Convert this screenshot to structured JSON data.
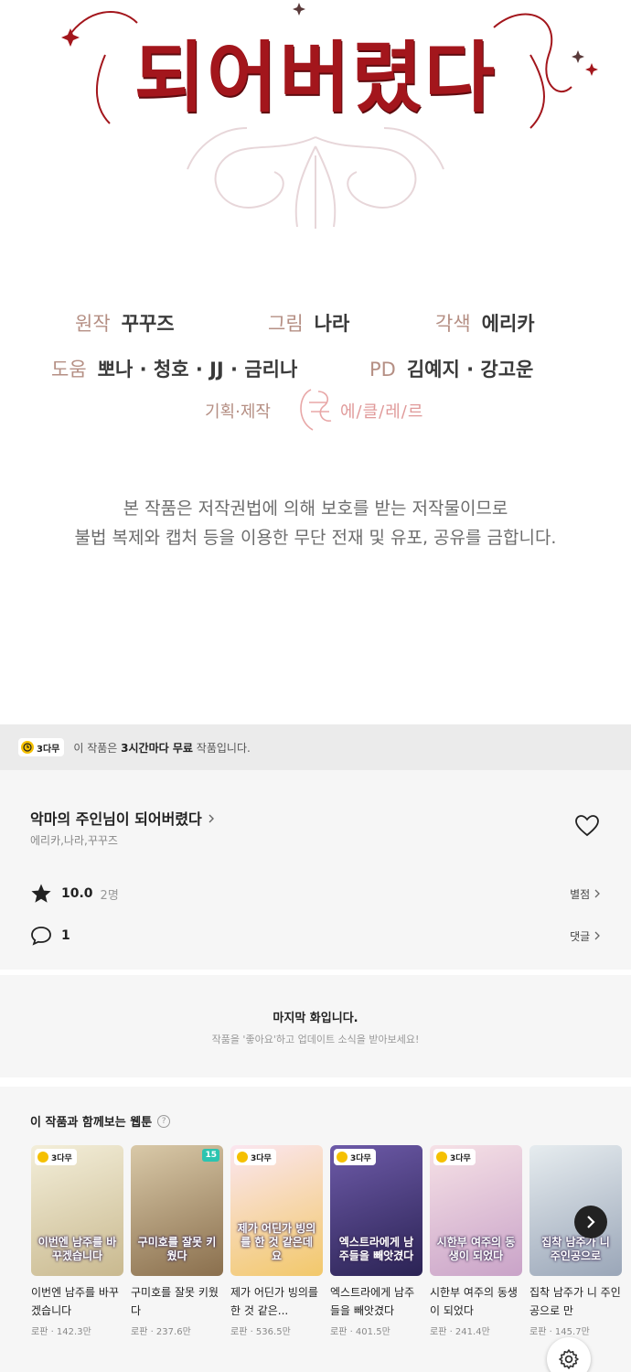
{
  "title_art": {
    "title": "되어버렸다"
  },
  "credits": {
    "original_label": "원작",
    "original_value": "꾸꾸즈",
    "art_label": "그림",
    "art_value": "나라",
    "adapt_label": "각색",
    "adapt_value": "에리카",
    "assist_label": "도움",
    "assist_value": "뽀나 · 청호 · JJ · 금리나",
    "pd_label": "PD",
    "pd_value": "김예지 · 강고운",
    "studio_label": "기획·제작",
    "studio_name": "에/클/레/르"
  },
  "copyright": {
    "line1": "본 작품은 저작권법에 의해 보호를 받는 저작물이므로",
    "line2": "불법 복제와 캡처 등을 이용한 무단 전재 및 유포, 공유를 금합니다."
  },
  "free_bar": {
    "badge": "3다무",
    "text_prefix": "이 작품은",
    "text_bold": "3시간마다 무료",
    "text_suffix": "작품입니다."
  },
  "series": {
    "title": "악마의 주인님이 되어버렸다",
    "authors": "에리카,나라,꾸꾸즈",
    "rating": "10.0",
    "rating_count": "2명",
    "rating_link": "별점",
    "comments": "1",
    "comment_link": "댓글"
  },
  "last_episode": {
    "title": "마지막 화입니다.",
    "subtitle": "작품을 '좋아요'하고 업데이트 소식을 받아보세요!"
  },
  "recommendations": {
    "heading": "이 작품과 함께보는 웹툰",
    "help": "?",
    "items": [
      {
        "badge": "3다무",
        "ep": "",
        "cover": "이번엔 남주를 바꾸겠습니다",
        "title": "이번엔 남주를 바꾸겠습니다",
        "meta": "로판 · 142.3만",
        "c1": "#f3eed9",
        "c2": "#c9b98f"
      },
      {
        "badge": "",
        "ep": "15",
        "cover": "구미호를 잘못 키웠다",
        "title": "구미호를 잘못 키웠다",
        "meta": "로판 · 237.6만",
        "c1": "#d9c9a8",
        "c2": "#8a6f4d"
      },
      {
        "badge": "3다무",
        "ep": "",
        "cover": "제가 어딘가 빙의를 한 것 같은데요",
        "title": "제가 어딘가 빙의를 한 것 같은...",
        "meta": "로판 · 536.5만",
        "c1": "#fbe6f0",
        "c2": "#f2c86a"
      },
      {
        "badge": "3다무",
        "ep": "",
        "cover": "엑스트라에게 남주들을 빼앗겼다",
        "title": "엑스트라에게 남주들을 빼앗겼다",
        "meta": "로판 · 401.5만",
        "c1": "#6d5aa8",
        "c2": "#2b2354"
      },
      {
        "badge": "3다무",
        "ep": "",
        "cover": "시한부 여주의 동생이 되었다",
        "title": "시한부 여주의 동생이 되었다",
        "meta": "로판 · 241.4만",
        "c1": "#f6e1e6",
        "c2": "#c9a3c8"
      },
      {
        "badge": "",
        "ep": "",
        "cover": "집착 남주가 니 주인공으로",
        "title": "집착 남주가 니 주인공으로 만",
        "meta": "로판 · 145.7만",
        "c1": "#e6ecef",
        "c2": "#9aa6b8"
      }
    ]
  },
  "colors": {
    "title_red": "#a3161c",
    "badge_yellow": "#f5c000",
    "ep_teal": "#2bc4b0"
  },
  "icons": [
    "clock-icon",
    "heart-icon",
    "star-icon",
    "comment-icon",
    "chevron-right-icon",
    "help-icon",
    "settings-icon"
  ]
}
